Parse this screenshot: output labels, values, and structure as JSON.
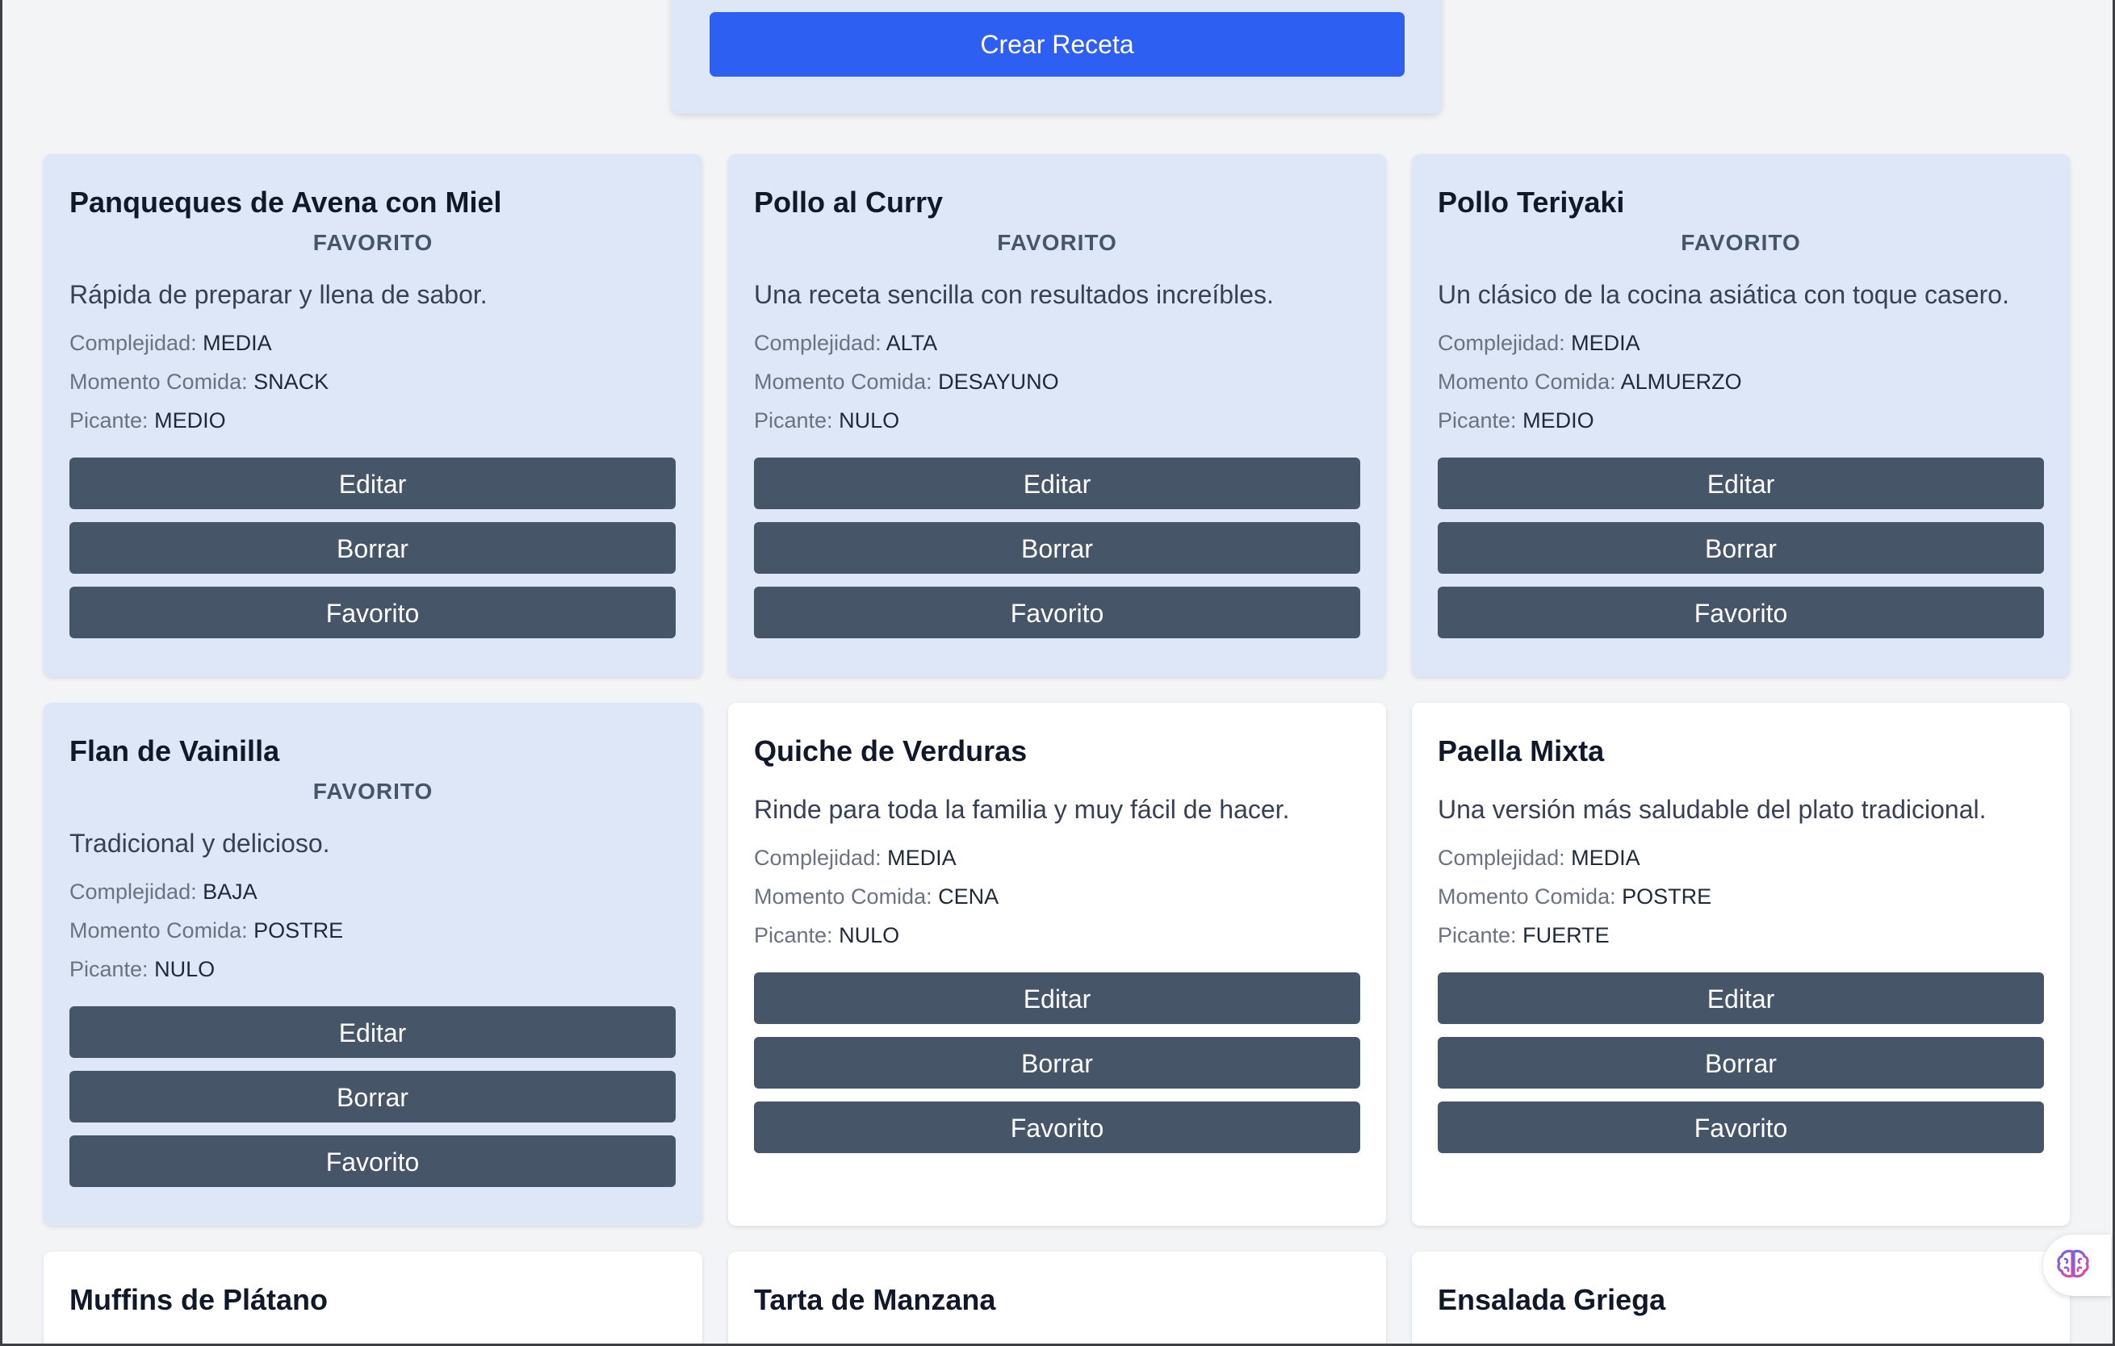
{
  "form": {
    "create_label": "Crear Receta"
  },
  "labels": {
    "complexity": "Complejidad:",
    "meal_time": "Momento Comida:",
    "spicy": "Picante:",
    "edit": "Editar",
    "delete": "Borrar",
    "favorite": "Favorito"
  },
  "colors": {
    "primary": "#2d5ff3",
    "card_button": "#475569",
    "favorite_card_bg": "#dde7f8",
    "plain_card_bg": "#ffffff",
    "page_bg": "#f3f4f6"
  },
  "recipes": [
    {
      "title": "Panqueques de Avena con Miel",
      "badge": "FAVORITO",
      "description": "Rápida de preparar y llena de sabor.",
      "complexity": "MEDIA",
      "meal_time": "SNACK",
      "spicy": "MEDIO"
    },
    {
      "title": "Pollo al Curry",
      "badge": "FAVORITO",
      "description": "Una receta sencilla con resultados increíbles.",
      "complexity": "ALTA",
      "meal_time": "DESAYUNO",
      "spicy": "NULO"
    },
    {
      "title": "Pollo Teriyaki",
      "badge": "FAVORITO",
      "description": "Un clásico de la cocina asiática con toque casero.",
      "complexity": "MEDIA",
      "meal_time": "ALMUERZO",
      "spicy": "MEDIO"
    },
    {
      "title": "Flan de Vainilla",
      "badge": "FAVORITO",
      "description": "Tradicional y delicioso.",
      "complexity": "BAJA",
      "meal_time": "POSTRE",
      "spicy": "NULO"
    },
    {
      "title": "Quiche de Verduras",
      "badge": "",
      "description": "Rinde para toda la familia y muy fácil de hacer.",
      "complexity": "MEDIA",
      "meal_time": "CENA",
      "spicy": "NULO"
    },
    {
      "title": "Paella Mixta",
      "badge": "",
      "description": "Una versión más saludable del plato tradicional.",
      "complexity": "MEDIA",
      "meal_time": "POSTRE",
      "spicy": "FUERTE"
    },
    {
      "title": "Muffins de Plátano"
    },
    {
      "title": "Tarta de Manzana"
    },
    {
      "title": "Ensalada Griega"
    }
  ],
  "floating_action": {
    "icon": "brain-icon"
  }
}
